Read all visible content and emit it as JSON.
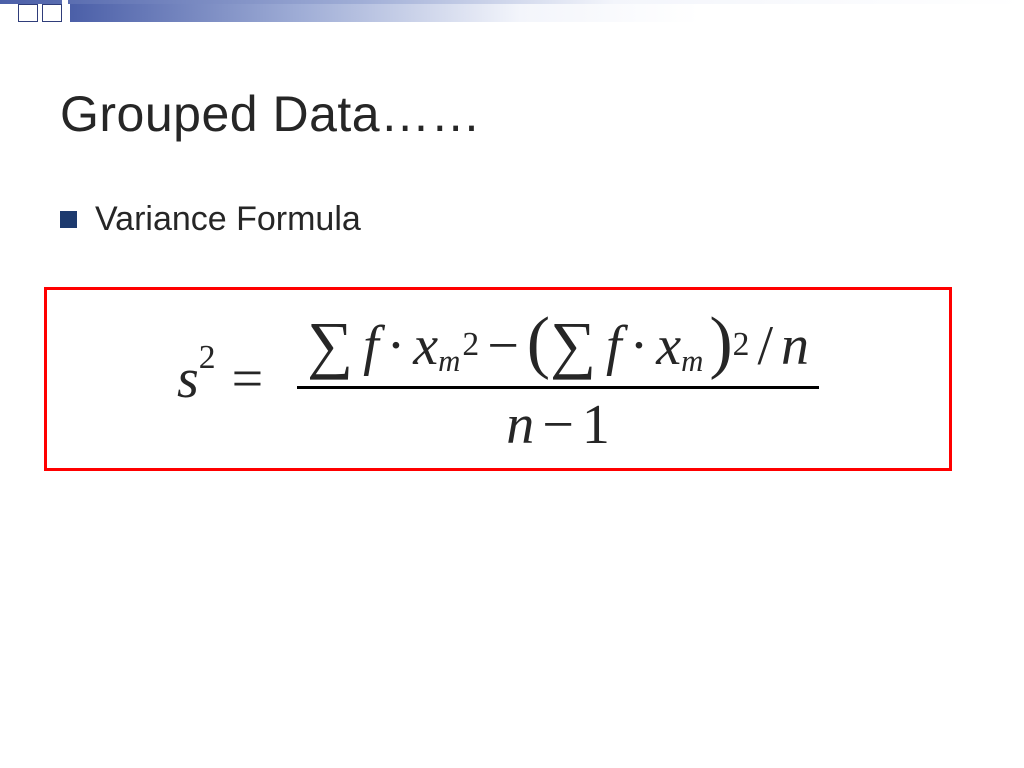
{
  "slide": {
    "title": "Grouped Data……",
    "bullet": "Variance Formula"
  },
  "formula": {
    "lhs_base": "s",
    "lhs_exp": "2",
    "equals": "=",
    "sigma": "∑",
    "f": "f",
    "dot": "·",
    "x": "x",
    "x_sub": "m",
    "sq_exp": "2",
    "minus": "−",
    "lparen": "(",
    "rparen": ")",
    "slash": "/",
    "n": "n",
    "den_n": "n",
    "den_minus": "−",
    "den_one": "1"
  }
}
